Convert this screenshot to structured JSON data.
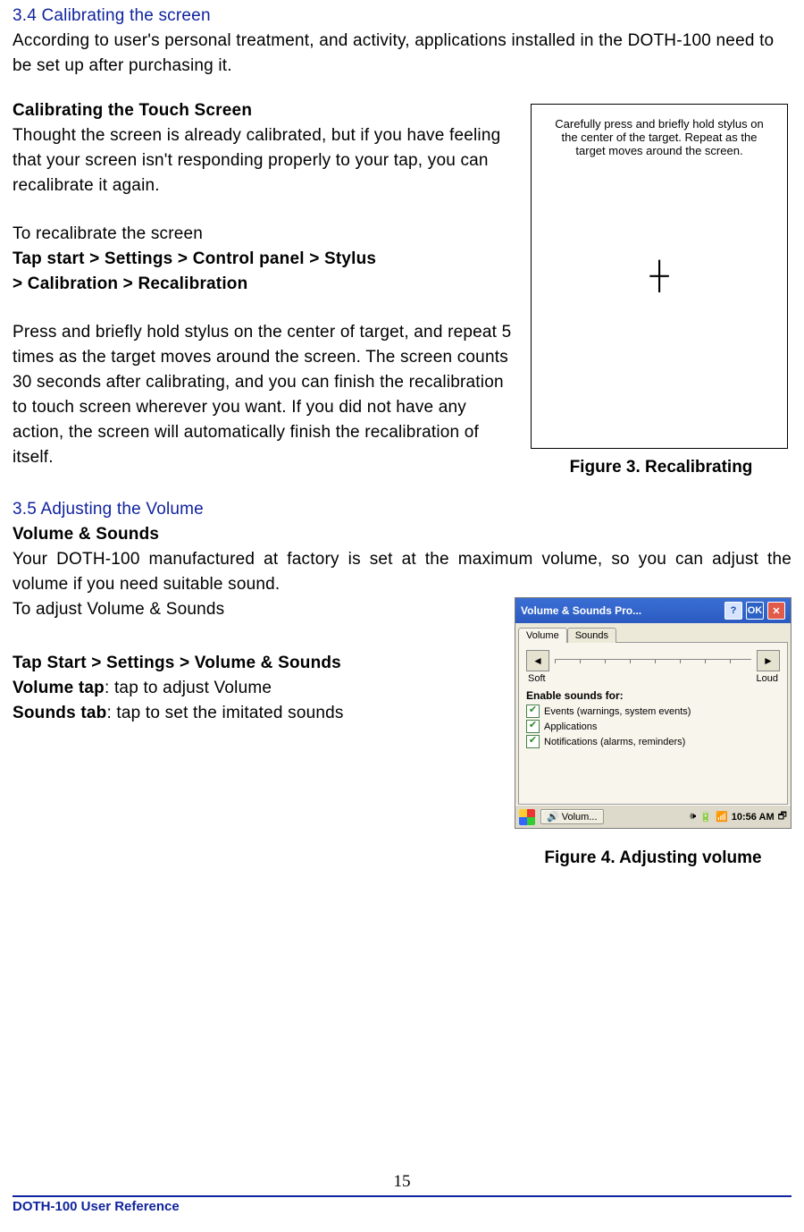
{
  "section34": {
    "title": "3.4 Calibrating the screen",
    "intro": "According to user's personal treatment, and activity, applications installed in the DOTH-100 need to be set up after purchasing it.",
    "sub1": "Calibrating the Touch Screen",
    "p1": "Thought the screen is already calibrated, but if you have feeling that your screen isn't responding properly to your tap, you can recalibrate it again.",
    "p2": "To recalibrate the screen",
    "path": "Tap start > Settings > Control panel > Stylus",
    "path2": "> Calibration > Recalibration",
    "p3": "Press and briefly hold stylus on the center of target, and repeat 5 times as the target moves around the screen. The screen counts 30 seconds after calibrating, and you can finish the recalibration to touch screen wherever you want. If you did not have any action, the screen will automatically finish the recalibration of itself.",
    "fig_text1": "Carefully press and briefly hold stylus on",
    "fig_text2": "the center of the target.  Repeat as the",
    "fig_text3": "target moves around the screen.",
    "caption": "Figure 3. Recalibrating"
  },
  "section35": {
    "title": "3.5 Adjusting the Volume",
    "sub1": "Volume & Sounds",
    "p1": "Your DOTH-100 manufactured at factory is set at the maximum volume, so you can adjust the volume if you need suitable sound.",
    "p2": "To adjust Volume & Sounds",
    "path": "Tap Start > Settings > Volume & Sounds",
    "line_vt_label": "Volume tap",
    "line_vt_rest": ": tap to adjust Volume",
    "line_st_label": "Sounds tab",
    "line_st_rest": ": tap to set the imitated sounds",
    "caption": "Figure 4. Adjusting volume"
  },
  "vol": {
    "title": "Volume & Sounds Pro...",
    "help": "?",
    "ok": "OK",
    "close": "✕",
    "tab1": "Volume",
    "tab2": "Sounds",
    "left": "◄",
    "right": "►",
    "soft": "Soft",
    "loud": "Loud",
    "enable": "Enable sounds for:",
    "chk1": "Events (warnings, system events)",
    "chk2": "Applications",
    "chk3": "Notifications (alarms, reminders)",
    "task": "Volum...",
    "time": "10:56 AM"
  },
  "footer": {
    "page": "15",
    "doc": "DOTH-100 User Reference"
  }
}
